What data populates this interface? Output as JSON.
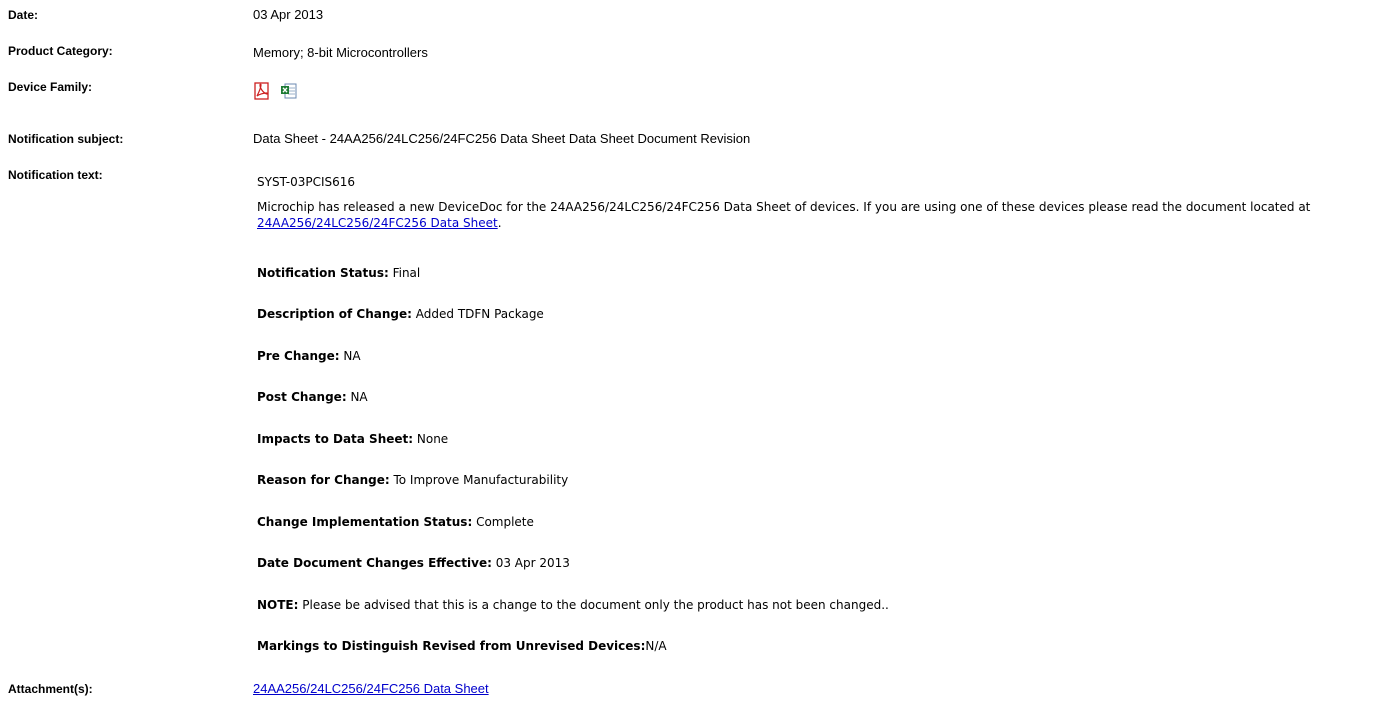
{
  "fields": {
    "date_label": "Date:",
    "date_value": "03 Apr 2013",
    "category_label": "Product Category:",
    "category_value": "Memory; 8-bit Microcontrollers",
    "family_label": "Device Family:",
    "family_icons": [
      "pdf-file-icon",
      "excel-file-icon"
    ],
    "subject_label": "Notification subject:",
    "subject_value": "Data Sheet - 24AA256/24LC256/24FC256 Data Sheet Data Sheet Document Revision",
    "text_label": "Notification text:",
    "attachments_label": "Attachment(s):",
    "attachment_link": "24AA256/24LC256/24FC256 Data Sheet"
  },
  "notification": {
    "id": "SYST-03PCIS616",
    "intro_before": "Microchip has released a new DeviceDoc for the 24AA256/24LC256/24FC256 Data Sheet of devices. If you are using one of these devices please read the document located at ",
    "intro_link": "24AA256/24LC256/24FC256 Data Sheet",
    "intro_after": ".",
    "status_label": "Notification Status:",
    "status_value": " Final",
    "desc_label": "Description of Change:",
    "desc_value": " Added TDFN Package",
    "pre_label": "Pre Change:",
    "pre_value": " NA",
    "post_label": "Post Change:",
    "post_value": " NA",
    "impacts_label": "Impacts to Data Sheet:",
    "impacts_value": " None",
    "reason_label": "Reason for Change:",
    "reason_value": " To Improve Manufacturability",
    "impl_label": "Change Implementation Status:",
    "impl_value": " Complete",
    "effective_label": "Date Document Changes Effective:",
    "effective_value": " 03 Apr 2013",
    "note_label": "NOTE:",
    "note_value": " Please be advised that this is a change to the document only the product has not been changed..",
    "markings_label": "Markings to Distinguish Revised from Unrevised Devices:",
    "markings_value": "N/A"
  },
  "colors": {
    "link": "#0000cc",
    "pdf_red": "#cc1f1f",
    "excel_green": "#1e7b34"
  }
}
